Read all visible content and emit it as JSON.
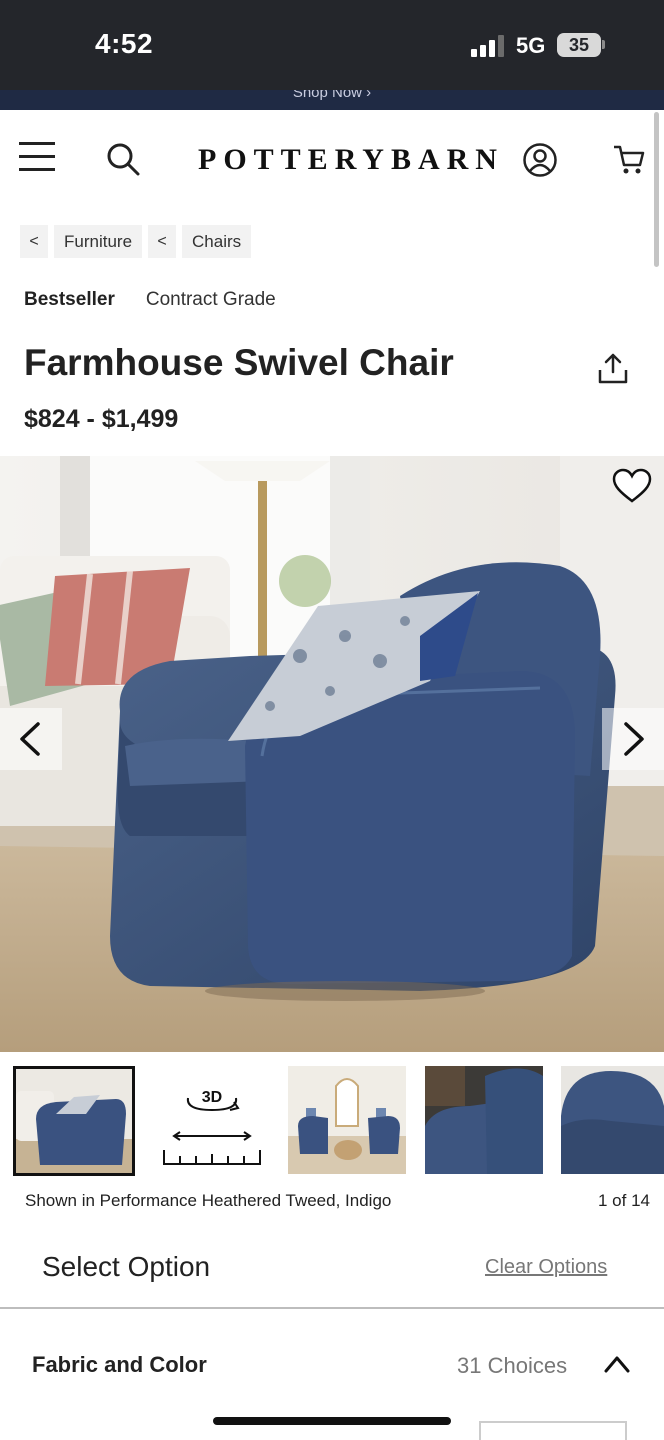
{
  "status_bar": {
    "time": "4:52",
    "network": "5G",
    "battery": "35"
  },
  "promo": {
    "text": "Shop Now ›"
  },
  "header": {
    "logo": "POTTERYBARN"
  },
  "breadcrumb": {
    "items": [
      "Furniture",
      "Chairs"
    ],
    "separator": "<"
  },
  "badges": [
    "Bestseller",
    "Contract Grade"
  ],
  "product": {
    "title": "Farmhouse Swivel Chair",
    "price": "$824 - $1,499"
  },
  "thumbnails": {
    "three_d_label": "3D",
    "count_visible": 5
  },
  "gallery": {
    "caption": "Shown in Performance Heathered Tweed, Indigo",
    "counter": "1 of 14"
  },
  "options": {
    "title": "Select Option",
    "clear_label": "Clear Options",
    "fabric_label": "Fabric and Color",
    "fabric_choices": "31 Choices"
  },
  "colors": {
    "status_bg": "#24262b",
    "promo_bg": "#1f2a44",
    "chair_blue": "#3d5580",
    "text": "#222222"
  }
}
